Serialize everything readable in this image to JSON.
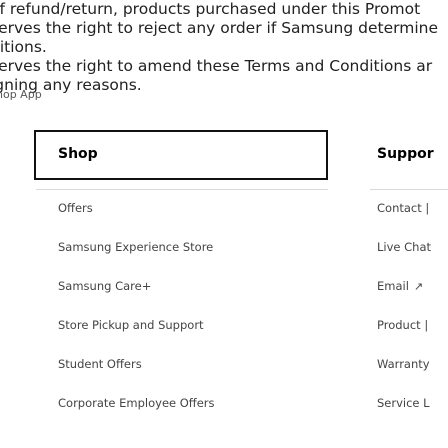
{
  "terms": {
    "lines": [
      " of refund/return, products purchased under this Promot",
      "serves the right to reject any order if Samsung determine",
      "ditions.",
      "serves the right to amend these Terms and Conditions ar",
      "igning any reasons."
    ]
  },
  "shop_app_label": "hop App",
  "shop": {
    "header": "Shop",
    "items": [
      "Offers",
      "Samsung Experience Store",
      "Samsung Care+",
      "Store Pickup and Support",
      "Student Offers",
      "Corporate Employee Offers"
    ]
  },
  "support": {
    "header": "Suppor",
    "items": [
      "Contact |",
      "Live Chat",
      "Email",
      "Product |",
      "Warranty",
      "Service L"
    ],
    "email_icon": "external-link-icon",
    "email_icon_glyph": "↗"
  }
}
